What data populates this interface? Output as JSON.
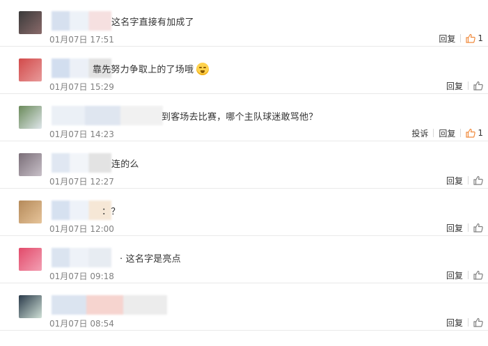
{
  "comments": [
    {
      "text": "这名字直接有加成了",
      "time": "01月07日 17:51",
      "reply": "回复",
      "report": "",
      "likes": "1",
      "liked": true,
      "avatar_colors": [
        "#3a3a3a",
        "#8a6a6a"
      ],
      "mosaic_colors": [
        "#c9d6ea",
        "#e8eef6",
        "#f3d6d6"
      ]
    },
    {
      "text": "靠先努力争取上的了场哦",
      "time": "01月07日 15:29",
      "reply": "回复",
      "report": "",
      "likes": "",
      "liked": false,
      "emoji": "shy-face-emoji",
      "avatar_colors": [
        "#d24a4a",
        "#e89a9a"
      ],
      "mosaic_colors": [
        "#c4d3ea",
        "#e6ecf5",
        "#d9d9d9"
      ]
    },
    {
      "text": "到客场去比赛，哪个主队球迷敢骂他？",
      "time": "01月07日 14:23",
      "reply": "回复",
      "report": "投诉",
      "likes": "1",
      "liked": true,
      "avatar_colors": [
        "#6a8a5a",
        "#dfe6ea"
      ],
      "mosaic_colors": [
        "#e5ebf3",
        "#d5deec",
        "#ededed"
      ]
    },
    {
      "text": "连的么",
      "time": "01月07日 12:27",
      "reply": "回复",
      "report": "",
      "likes": "",
      "liked": false,
      "avatar_colors": [
        "#7a6e78",
        "#c8c0c8"
      ],
      "mosaic_colors": [
        "#d6e0ee",
        "#eef2f8",
        "#dadada"
      ]
    },
    {
      "text": "：？",
      "time": "01月07日 12:00",
      "reply": "回复",
      "report": "",
      "likes": "",
      "liked": false,
      "avatar_colors": [
        "#b58a5a",
        "#e6c49a"
      ],
      "mosaic_colors": [
        "#c9d7ec",
        "#e9eef7",
        "#f3dfc9"
      ]
    },
    {
      "text": "· 这名字是亮点",
      "time": "01月07日 09:18",
      "reply": "回复",
      "report": "",
      "likes": "",
      "liked": false,
      "avatar_colors": [
        "#e24a6a",
        "#f3a0b4"
      ],
      "mosaic_colors": [
        "#cfdbec",
        "#e9eef6",
        "#e0e6ee"
      ]
    },
    {
      "text": "",
      "time": "01月07日 08:54",
      "reply": "回复",
      "report": "",
      "likes": "",
      "liked": false,
      "avatar_colors": [
        "#2a3a4a",
        "#cfe0d6"
      ],
      "mosaic_colors": [
        "#cfdbec",
        "#f3c6c0",
        "#e6e6e6"
      ]
    }
  ],
  "colors": {
    "liked": "#f08a3c",
    "unliked": "#808080",
    "meta": "#808080",
    "divider": "#e9e9e9"
  }
}
